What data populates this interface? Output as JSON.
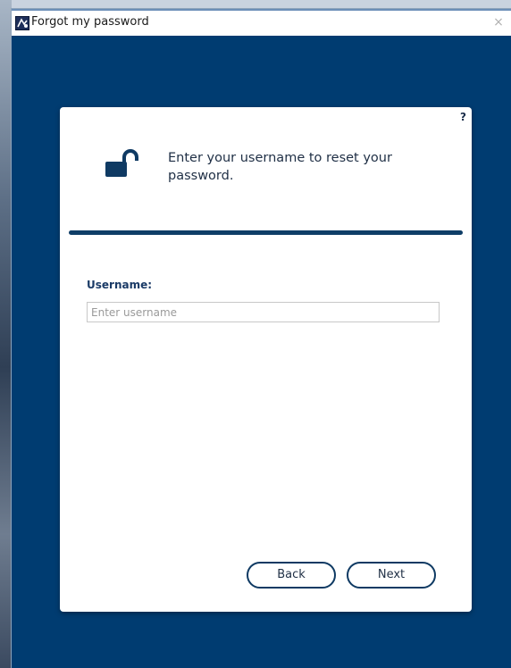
{
  "window": {
    "title": "Forgot my password",
    "close_label": "×"
  },
  "card": {
    "help_label": "?",
    "header_text": "Enter your username to reset your password.",
    "username_label": "Username:",
    "username_placeholder": "Enter username",
    "username_value": "",
    "back_label": "Back",
    "next_label": "Next"
  },
  "icons": {
    "app": "app-logo-icon",
    "lock": "unlocked-padlock-icon"
  },
  "colors": {
    "background": "#003c71",
    "card": "#ffffff",
    "accent": "#0f3e67",
    "label": "#1a3a66"
  }
}
